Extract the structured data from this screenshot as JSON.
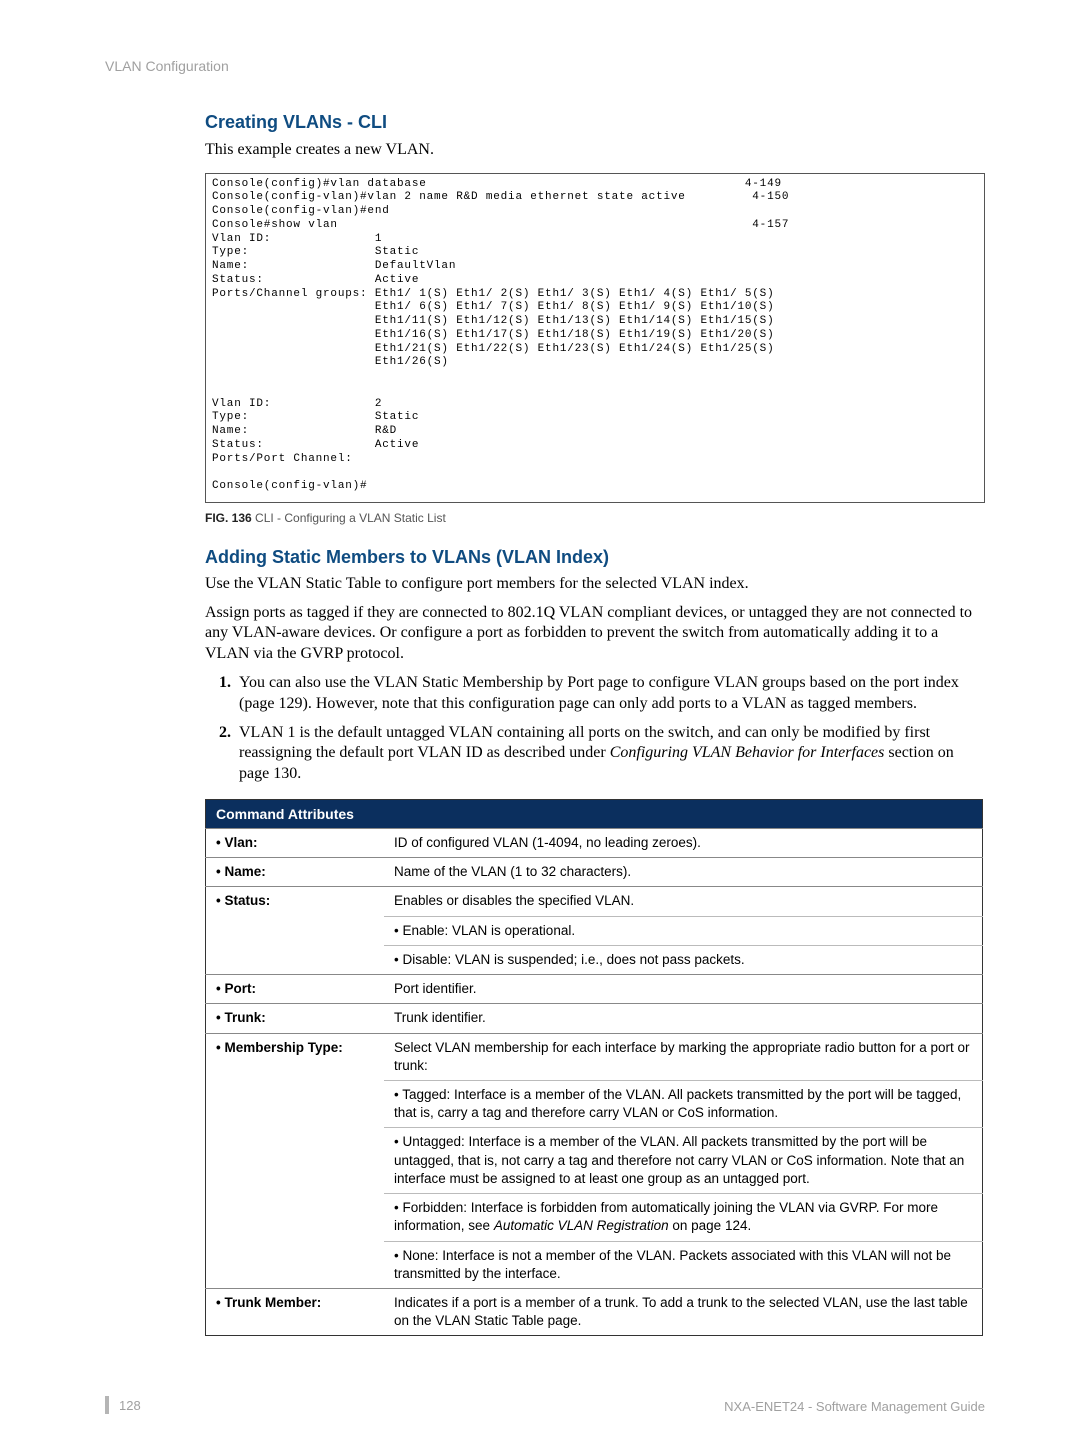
{
  "breadcrumb": "VLAN Configuration",
  "h2_1": "Creating VLANs - CLI",
  "intro_1": "This example creates a new VLAN.",
  "console": "Console(config)#vlan database                                           4-149\nConsole(config-vlan)#vlan 2 name R&D media ethernet state active         4-150\nConsole(config-vlan)#end\nConsole#show vlan                                                        4-157\nVlan ID:              1\nType:                 Static\nName:                 DefaultVlan\nStatus:               Active\nPorts/Channel groups: Eth1/ 1(S) Eth1/ 2(S) Eth1/ 3(S) Eth1/ 4(S) Eth1/ 5(S)\n                      Eth1/ 6(S) Eth1/ 7(S) Eth1/ 8(S) Eth1/ 9(S) Eth1/10(S)\n                      Eth1/11(S) Eth1/12(S) Eth1/13(S) Eth1/14(S) Eth1/15(S)\n                      Eth1/16(S) Eth1/17(S) Eth1/18(S) Eth1/19(S) Eth1/20(S)\n                      Eth1/21(S) Eth1/22(S) Eth1/23(S) Eth1/24(S) Eth1/25(S)\n                      Eth1/26(S)\n\n\nVlan ID:              2\nType:                 Static\nName:                 R&D\nStatus:               Active\nPorts/Port Channel:\n\nConsole(config-vlan)#",
  "fig_num": "FIG. 136",
  "fig_text": "  CLI - Configuring a VLAN Static List",
  "h2_2": "Adding Static Members to VLANs (VLAN Index)",
  "para_2a": "Use the VLAN Static Table to configure port members for the selected VLAN index.",
  "para_2b": "Assign ports as tagged if they are connected to 802.1Q VLAN compliant devices, or untagged they are not connected to any VLAN-aware devices. Or configure a port as forbidden to prevent the switch from automatically adding it to a VLAN via the GVRP protocol.",
  "li_1": "You can also use the VLAN Static Membership by Port page to configure VLAN groups based on the port index (page 129). However, note that this configuration page can only add ports to a VLAN as tagged members.",
  "li_2a": "VLAN 1 is the default untagged VLAN containing all ports on the switch, and can only be modified by first reassigning the default port VLAN ID as described under ",
  "li_2b": "Configuring VLAN Behavior for Interfaces",
  "li_2c": " section on page 130.",
  "table_header": "Command Attributes",
  "rows": [
    {
      "label": "• Vlan:",
      "desc": "ID of configured VLAN (1-4094, no leading zeroes)."
    },
    {
      "label": "• Name:",
      "desc": "Name of the VLAN (1 to 32 characters)."
    },
    {
      "label": "• Status:",
      "desc": "Enables or disables the specified VLAN."
    },
    {
      "sub": "• Enable: VLAN is operational."
    },
    {
      "sub": "• Disable: VLAN is suspended; i.e., does not pass packets."
    },
    {
      "label": "• Port:",
      "desc": "Port identifier."
    },
    {
      "label": "• Trunk:",
      "desc": "Trunk identifier."
    },
    {
      "label": "• Membership Type:",
      "desc": "Select VLAN membership for each interface by marking the appropriate radio button for a port or trunk:"
    },
    {
      "sub": "• Tagged: Interface is a member of the VLAN. All packets transmitted by the port will be tagged, that is, carry a tag and therefore carry VLAN or CoS information."
    },
    {
      "sub": "• Untagged: Interface is a member of the VLAN. All packets transmitted by the port will be untagged, that is, not carry a tag and therefore not carry VLAN or CoS information. Note that an interface must be assigned to at least one group as an untagged port."
    },
    {
      "sub_html": "• Forbidden: Interface is forbidden from automatically joining the VLAN via GVRP. For more information, see <span class=\"em\">Automatic VLAN Registration</span> on page 124."
    },
    {
      "sub": "• None: Interface is not a member of the VLAN. Packets associated with this VLAN will not be transmitted by the interface."
    },
    {
      "label": "• Trunk Member:",
      "desc": "Indicates if a port is a member of a trunk. To add a trunk to the selected VLAN, use the last table on the VLAN Static Table page."
    }
  ],
  "page_number": "128",
  "footer_right": "NXA-ENET24 - Software Management Guide"
}
